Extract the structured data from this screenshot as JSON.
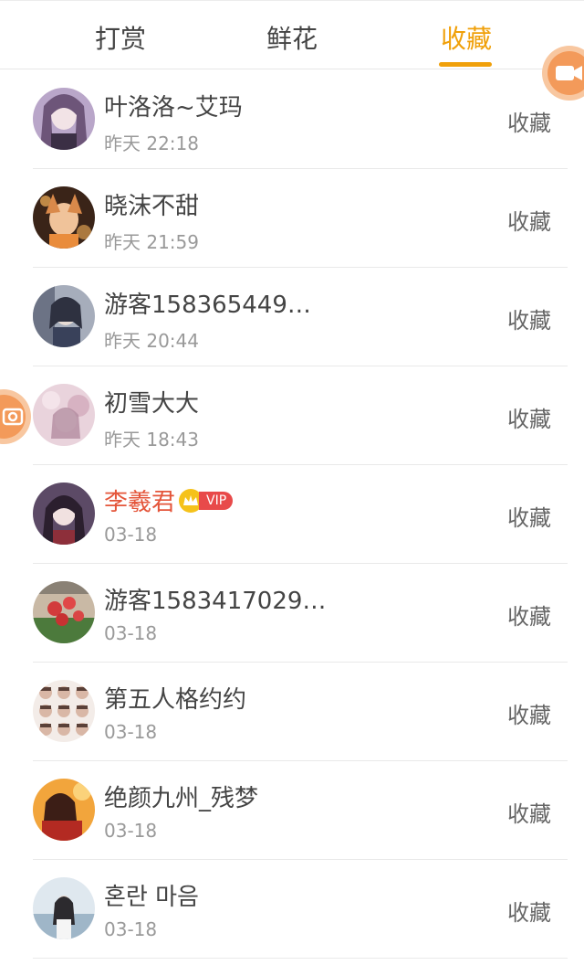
{
  "tabs": [
    {
      "label": "打赏",
      "active": false
    },
    {
      "label": "鲜花",
      "active": false
    },
    {
      "label": "收藏",
      "active": true
    }
  ],
  "accent_color": "#f0a00a",
  "vip_badge_label": "VIP",
  "items": [
    {
      "name": "叶洛洛~艾玛",
      "time": "昨天 22:18",
      "action": "收藏",
      "avatar_color": "#8a6f9a"
    },
    {
      "name": "晓沫不甜",
      "time": "昨天 21:59",
      "action": "收藏",
      "avatar_color": "#c0734a"
    },
    {
      "name": "游客158365449…",
      "time": "昨天 20:44",
      "action": "收藏",
      "avatar_color": "#3d4a63"
    },
    {
      "name": "初雪大大",
      "time": "昨天 18:43",
      "action": "收藏",
      "avatar_color": "#d9b4c3"
    },
    {
      "name": "李羲君",
      "time": "03-18",
      "action": "收藏",
      "avatar_color": "#4a3a55",
      "vip": true
    },
    {
      "name": "游客1583417029…",
      "time": "03-18",
      "action": "收藏",
      "avatar_color": "#5a7a4a"
    },
    {
      "name": "第五人格约约",
      "time": "03-18",
      "action": "收藏",
      "avatar_color": "#d8c4c0"
    },
    {
      "name": "绝颜九州_残梦",
      "time": "03-18",
      "action": "收藏",
      "avatar_color": "#b3452e"
    },
    {
      "name": "혼란 마음",
      "time": "03-18",
      "action": "收藏",
      "avatar_color": "#a8bfd0"
    }
  ],
  "floating": {
    "video_icon": "video-camera-icon",
    "camera_icon": "camera-icon"
  }
}
